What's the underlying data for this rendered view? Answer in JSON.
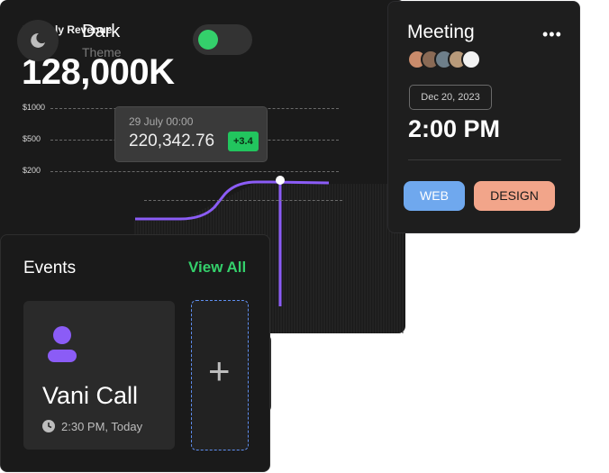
{
  "revenue": {
    "title": "Monthly Revenue",
    "value": "128,000K",
    "y_ticks": [
      "$1000",
      "$500",
      "$200"
    ],
    "tooltip": {
      "date": "29 July 00:00",
      "value": "220,342.76",
      "change": "+3.4"
    },
    "accent_color": "#8b5cf6"
  },
  "meeting": {
    "title": "Meeting",
    "menu_icon": "more-dots-icon",
    "date": "Dec 20, 2023",
    "time": "2:00 PM",
    "tags": [
      {
        "label": "WEB",
        "color": "#6fa8ee"
      },
      {
        "label": "DESIGN",
        "color": "#f2a58a"
      }
    ]
  },
  "events": {
    "title": "Events",
    "view_all": "View All",
    "event": {
      "icon": "person-icon",
      "name": "Vani Call",
      "time": "2:30 PM, Today"
    },
    "add_icon": "plus-icon",
    "accent_color": "#34d06b"
  },
  "theme": {
    "icon": "moon-icon",
    "label": "Dark",
    "sublabel": "Theme",
    "toggle_on": true
  }
}
